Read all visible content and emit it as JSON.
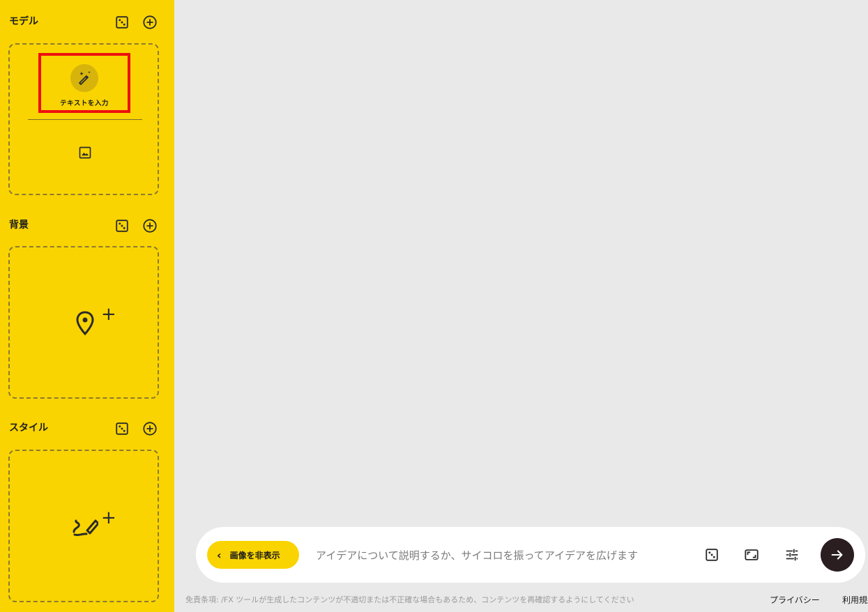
{
  "sidebar": {
    "sections": [
      {
        "title": "モデル",
        "dice_icon": "dice-icon",
        "add_icon": "plus-circle-icon"
      },
      {
        "title": "背景",
        "dice_icon": "dice-icon",
        "add_icon": "plus-circle-icon"
      },
      {
        "title": "スタイル",
        "dice_icon": "dice-icon",
        "add_icon": "plus-circle-icon"
      }
    ],
    "model_tile": {
      "label": "テキストを入力",
      "icon": "magic-wand-icon"
    },
    "model_image_icon": "image-icon",
    "background_icon": "location-pin-icon",
    "style_icon": "brush-icon",
    "plus_glyph": "+"
  },
  "prompt_bar": {
    "hide_button_label": "画像を非表示",
    "hide_button_icon": "chevron-left-icon",
    "placeholder": "アイデアについて説明するか、サイコロを振ってアイデアを広げます",
    "icons": [
      "dice-icon",
      "aspect-ratio-icon",
      "tune-icon",
      "arrow-right-icon"
    ]
  },
  "footer": {
    "disclaimer": "免責条項: /FX ツールが生成したコンテンツが不適切または不正確な場合もあるため、コンテンツを再確認するようにしてください",
    "privacy": "プライバシー",
    "terms": "利用規約"
  },
  "colors": {
    "sidebar_bg": "#f9d400",
    "canvas_bg": "#e9e9e9",
    "highlight": "#ee0f0f",
    "send_button": "#2a1e21"
  }
}
